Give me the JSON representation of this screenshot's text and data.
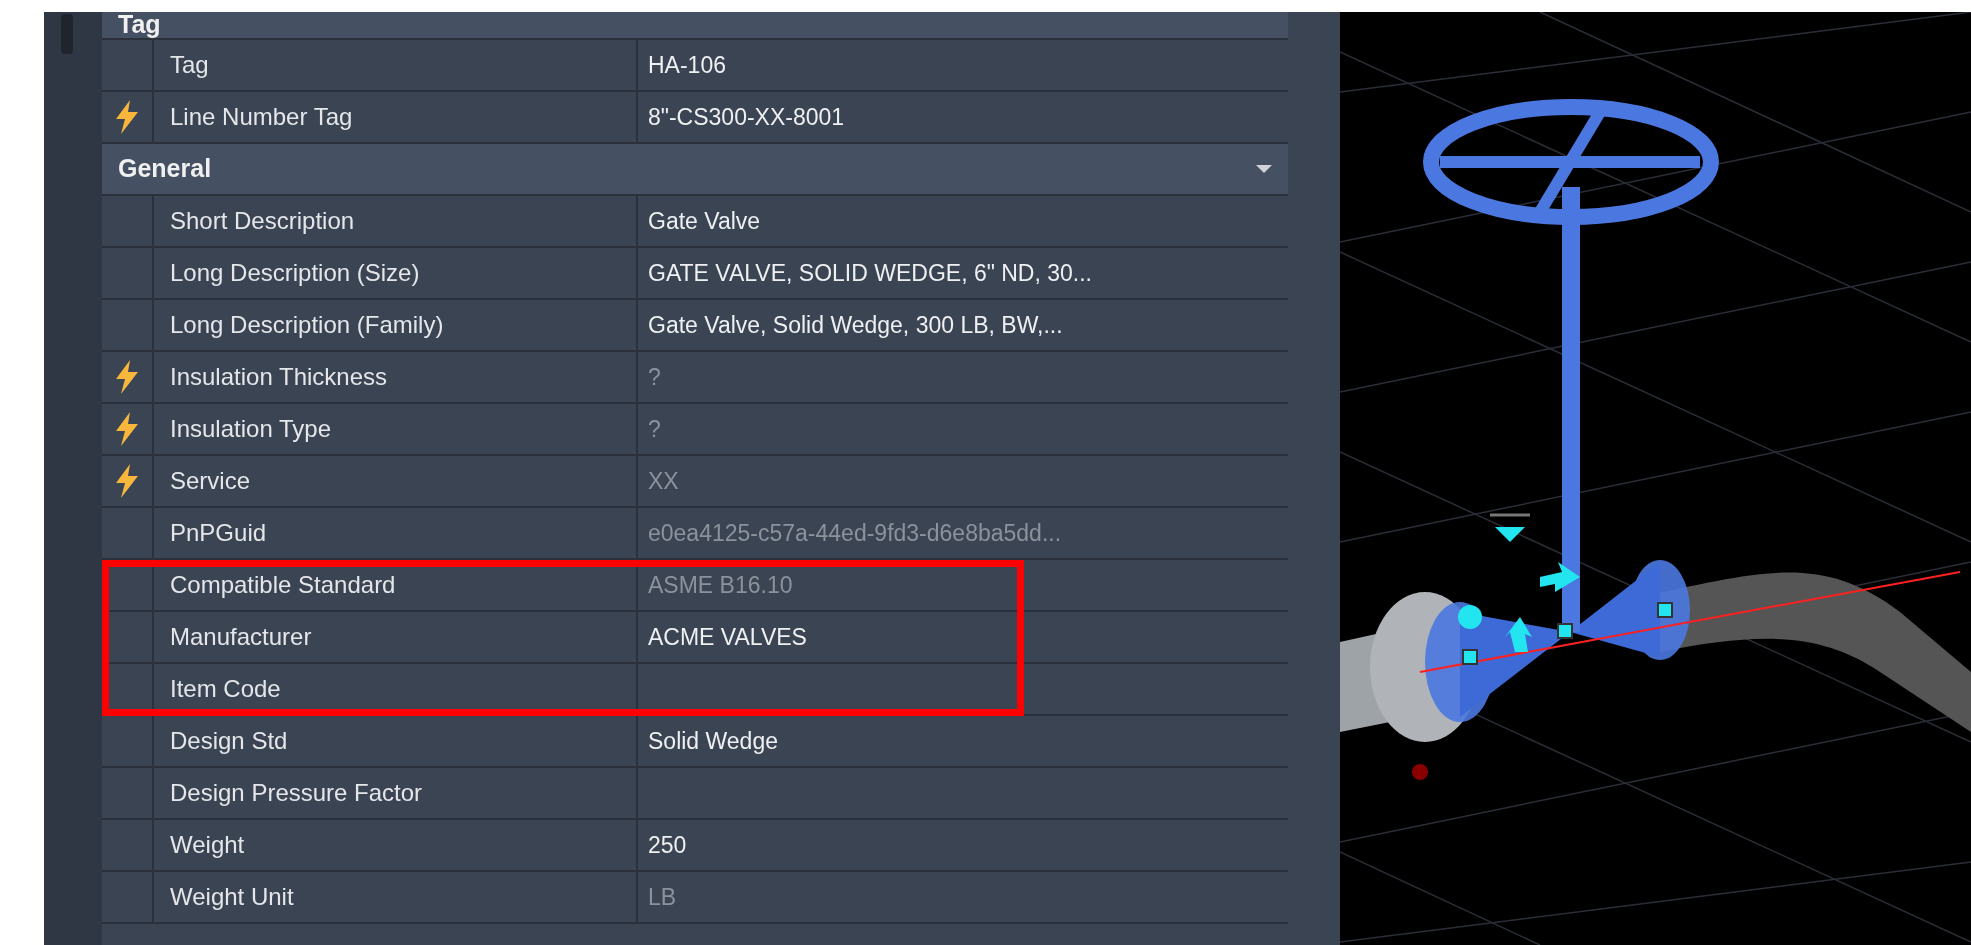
{
  "properties": [
    {
      "kind": "category",
      "label": "Tag"
    },
    {
      "kind": "property",
      "name": "Tag",
      "value": "HA-106",
      "linked": false,
      "dimmed": false,
      "highlighted": false
    },
    {
      "kind": "property",
      "name": "Line Number Tag",
      "value": "8\"-CS300-XX-8001",
      "linked": true,
      "dimmed": false,
      "highlighted": false
    },
    {
      "kind": "category",
      "label": "General",
      "expanded": true
    },
    {
      "kind": "property",
      "name": "Short Description",
      "value": "Gate Valve",
      "linked": false,
      "dimmed": false,
      "highlighted": false
    },
    {
      "kind": "property",
      "name": "Long Description (Size)",
      "value": "GATE VALVE, SOLID WEDGE, 6\" ND, 30...",
      "linked": false,
      "dimmed": false,
      "highlighted": false
    },
    {
      "kind": "property",
      "name": "Long Description (Family)",
      "value": "Gate Valve, Solid Wedge, 300 LB, BW,...",
      "linked": false,
      "dimmed": false,
      "highlighted": false
    },
    {
      "kind": "property",
      "name": "Insulation Thickness",
      "value": "?",
      "linked": true,
      "dimmed": true,
      "highlighted": false
    },
    {
      "kind": "property",
      "name": "Insulation Type",
      "value": "?",
      "linked": true,
      "dimmed": true,
      "highlighted": false
    },
    {
      "kind": "property",
      "name": "Service",
      "value": "XX",
      "linked": true,
      "dimmed": true,
      "highlighted": false
    },
    {
      "kind": "property",
      "name": "PnPGuid",
      "value": "e0ea4125-c57a-44ed-9fd3-d6e8ba5dd...",
      "linked": false,
      "dimmed": true,
      "highlighted": false
    },
    {
      "kind": "property",
      "name": "Compatible Standard",
      "value": "ASME B16.10",
      "linked": false,
      "dimmed": true,
      "highlighted": true
    },
    {
      "kind": "property",
      "name": "Manufacturer",
      "value": "ACME VALVES",
      "linked": false,
      "dimmed": false,
      "highlighted": true
    },
    {
      "kind": "property",
      "name": "Item Code",
      "linked": false,
      "highlighted": true
    },
    {
      "kind": "property",
      "name": "Design Std",
      "value": "Solid Wedge",
      "linked": false,
      "dimmed": false,
      "highlighted": false
    },
    {
      "kind": "property",
      "name": "Design Pressure Factor",
      "linked": false,
      "highlighted": false
    },
    {
      "kind": "property",
      "name": "Weight",
      "value": "250",
      "linked": false,
      "dimmed": false,
      "highlighted": false
    },
    {
      "kind": "property",
      "name": "Weight Unit",
      "value": "LB",
      "linked": false,
      "dimmed": true,
      "highlighted": false
    }
  ]
}
